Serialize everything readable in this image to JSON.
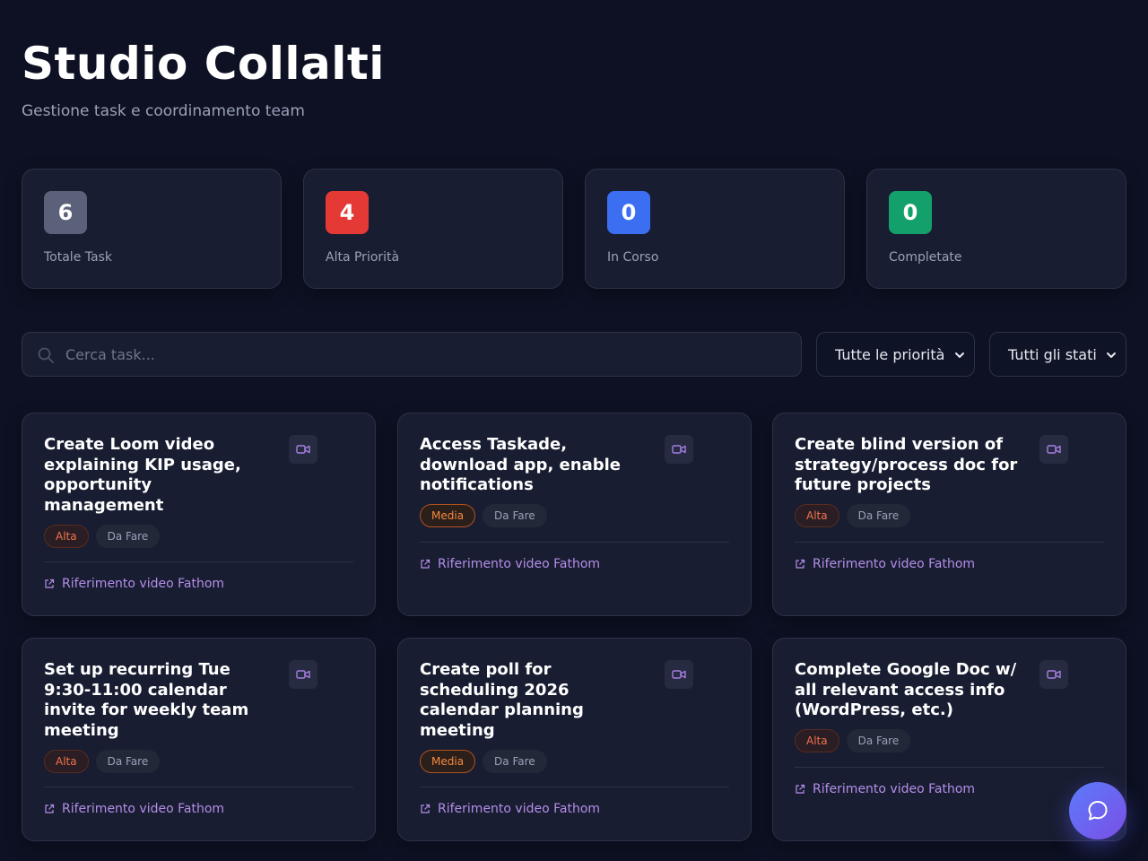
{
  "header": {
    "title": "Studio Collalti",
    "subtitle": "Gestione task e coordinamento team"
  },
  "stats": [
    {
      "value": "6",
      "label": "Totale Task",
      "color": "#5b6178"
    },
    {
      "value": "4",
      "label": "Alta Priorità",
      "color": "#e53935"
    },
    {
      "value": "0",
      "label": "In Corso",
      "color": "#3b6ef0"
    },
    {
      "value": "0",
      "label": "Completate",
      "color": "#14a06a"
    }
  ],
  "toolbar": {
    "search_placeholder": "Cerca task...",
    "priority_filter": "Tutte le priorità",
    "status_filter": "Tutti gli stati"
  },
  "tasks": [
    {
      "title": "Create Loom video explaining KIP usage, opportunity management",
      "priority": "Alta",
      "status": "Da Fare",
      "link": "Riferimento video Fathom"
    },
    {
      "title": "Access Taskade, download app, enable notifications",
      "priority": "Media",
      "status": "Da Fare",
      "link": "Riferimento video Fathom"
    },
    {
      "title": "Create blind version of strategy/process doc for future projects",
      "priority": "Alta",
      "status": "Da Fare",
      "link": "Riferimento video Fathom"
    },
    {
      "title": "Set up recurring Tue 9:30-11:00 calendar invite for weekly team meeting",
      "priority": "Alta",
      "status": "Da Fare",
      "link": "Riferimento video Fathom"
    },
    {
      "title": "Create poll for scheduling 2026 calendar planning meeting",
      "priority": "Media",
      "status": "Da Fare",
      "link": "Riferimento video Fathom"
    },
    {
      "title": "Complete Google Doc w/ all relevant access info (WordPress, etc.)",
      "priority": "Alta",
      "status": "Da Fare",
      "link": "Riferimento video Fathom"
    }
  ],
  "icons": {
    "search": "search-icon",
    "chevron": "chevron-down-icon",
    "video": "video-icon",
    "external_link": "external-link-icon",
    "chat": "chat-bubble-icon"
  }
}
